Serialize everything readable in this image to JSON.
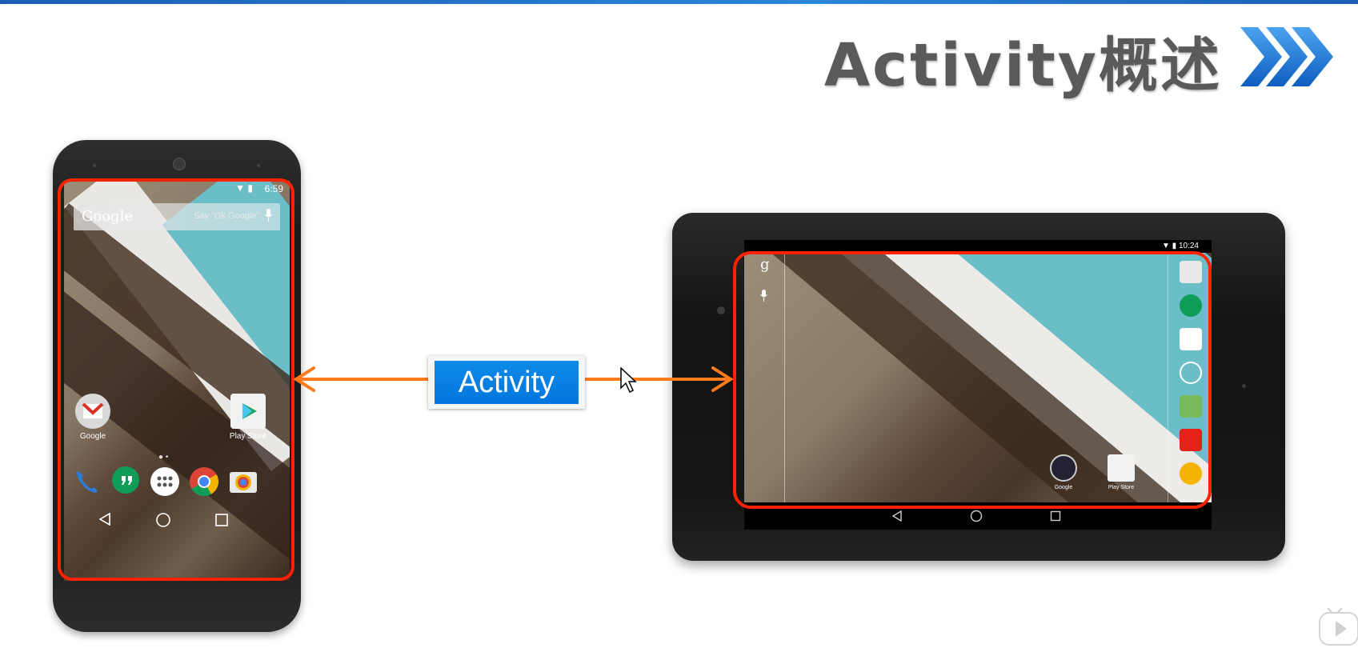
{
  "slide": {
    "title": "Activity概述",
    "label": "Activity"
  },
  "phone": {
    "time": "6:59",
    "search_brand": "Google",
    "search_hint": "Say \"Ok Google\"",
    "apps": [
      {
        "label": "Google",
        "icon": "gmail-icon"
      },
      {
        "label": "Play Store",
        "icon": "play-store-icon"
      }
    ],
    "dock": [
      "phone-icon",
      "hangouts-icon",
      "app-drawer-icon",
      "chrome-icon",
      "camera-icon"
    ]
  },
  "tablet": {
    "time": "10:24",
    "apps": [
      {
        "label": "Google",
        "icon": "google-folder-icon"
      },
      {
        "label": "Play Store",
        "icon": "play-store-icon"
      }
    ],
    "right_bar": [
      "camera-icon",
      "hangouts-icon",
      "gmail-icon",
      "app-drawer-icon",
      "maps-icon",
      "youtube-icon",
      "chrome-icon"
    ]
  },
  "colors": {
    "highlight": "#ff2200",
    "arrow": "#ff7a1a",
    "label_bg": "#0a84e6",
    "title": "#5a5a5a",
    "chevron": "#1e74d6"
  }
}
